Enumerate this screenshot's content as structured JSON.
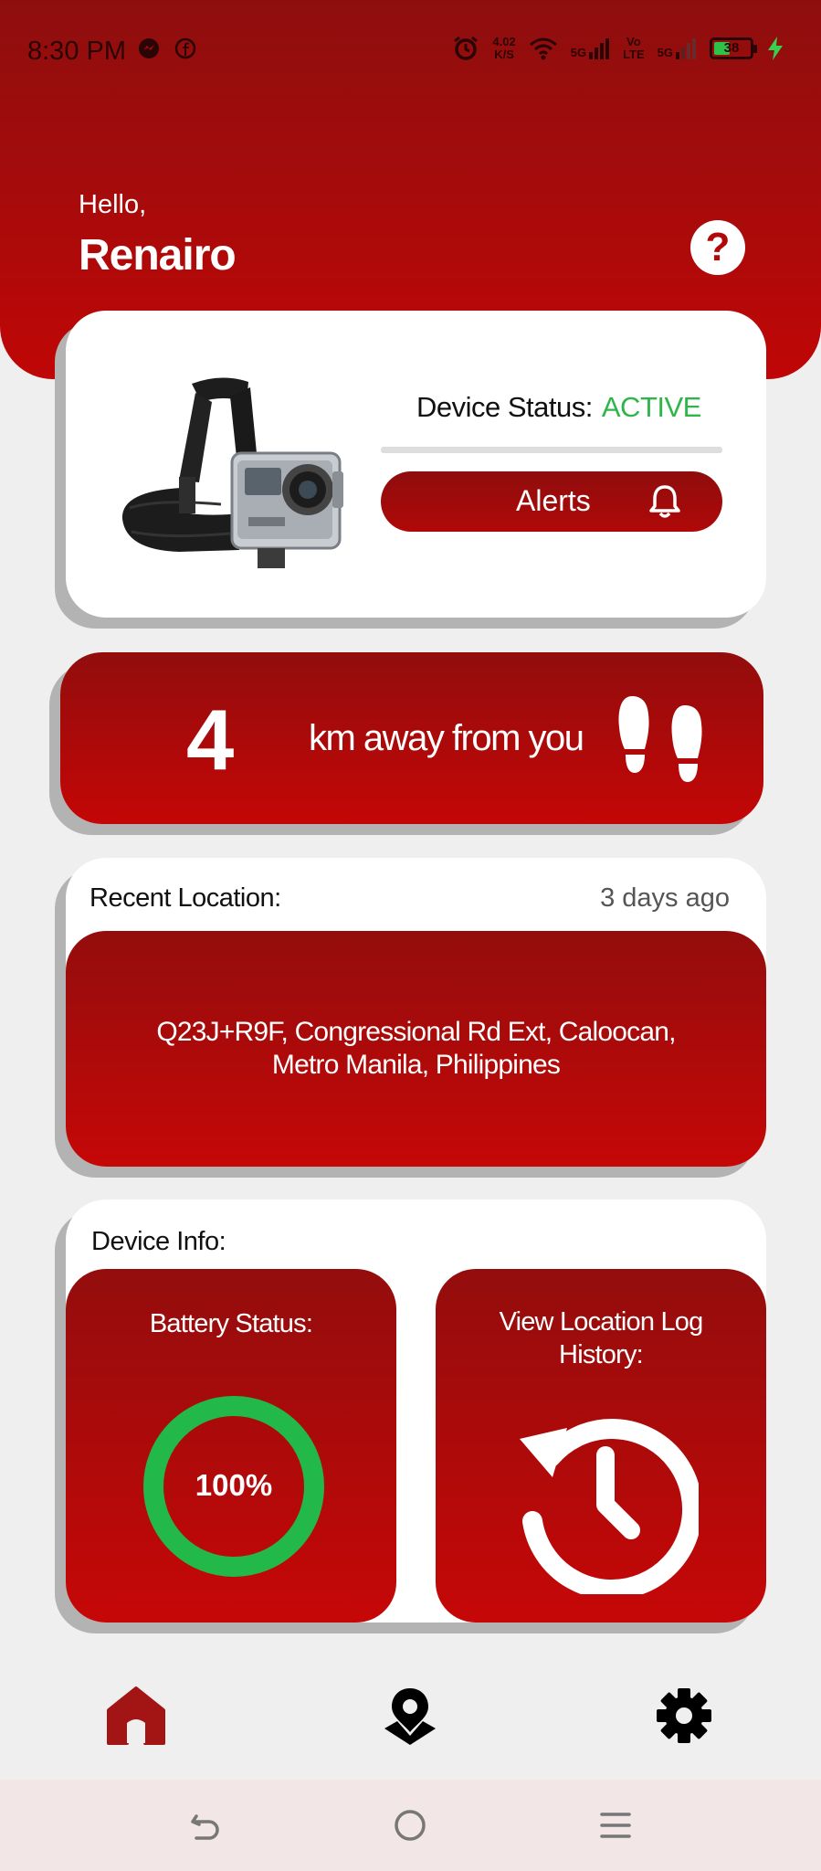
{
  "status_bar": {
    "time": "8:30 PM",
    "net_speed_value": "4.02",
    "net_speed_unit": "K/S",
    "signal1_label": "5G",
    "volte_top": "Vo",
    "volte_bottom": "LTE",
    "signal2_label": "5G",
    "battery_level": "38"
  },
  "header": {
    "greeting": "Hello,",
    "username": "Renairo",
    "help_label": "?"
  },
  "device_card": {
    "status_label": "Device Status:",
    "status_value": "ACTIVE",
    "alerts_label": "Alerts"
  },
  "distance_card": {
    "distance": "4",
    "distance_text": "km away from you"
  },
  "location_card": {
    "title": "Recent Location:",
    "time_ago": "3 days ago",
    "address": "Q23J+R9F, Congressional Rd Ext, Caloocan, Metro Manila, Philippines"
  },
  "device_info": {
    "title": "Device Info:",
    "battery_title": "Battery Status:",
    "battery_percent": "100%",
    "history_title": "View Location Log History:"
  },
  "colors": {
    "brand_red": "#b00808",
    "active_green": "#2fb64b",
    "battery_ring": "#22b84a"
  },
  "icons": {
    "help": "question-icon",
    "alerts": "bell-icon",
    "distance": "footsteps-icon",
    "history": "history-icon",
    "nav_home": "home-icon",
    "nav_map": "map-pin-icon",
    "nav_settings": "gear-icon"
  }
}
